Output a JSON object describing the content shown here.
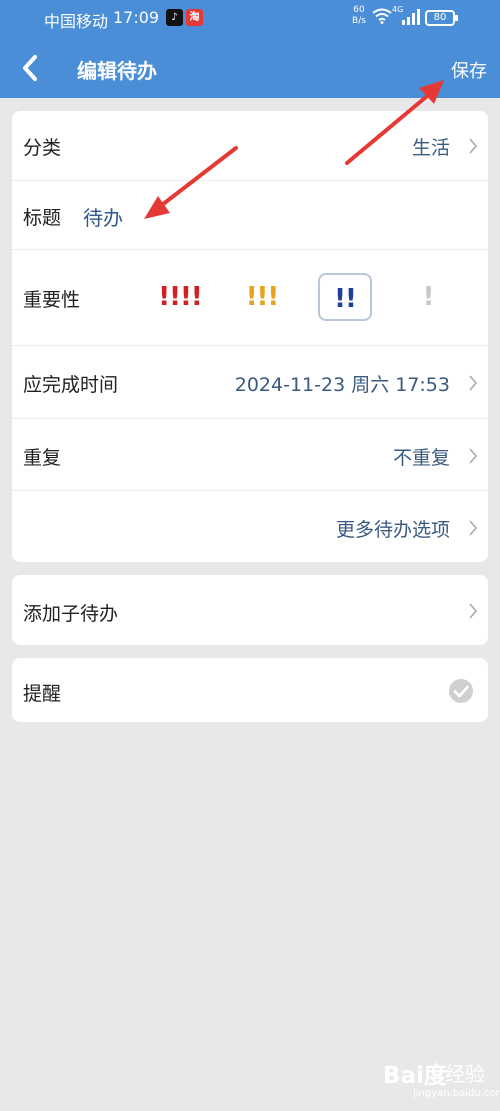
{
  "status_bar": {
    "carrier": "中国移动",
    "time": "17:09",
    "net_speed_value": "60",
    "net_speed_unit": "B/s",
    "network_type": "4G",
    "battery": "80"
  },
  "header": {
    "title": "编辑待办",
    "save_label": "保存"
  },
  "form": {
    "category": {
      "label": "分类",
      "value": "生活"
    },
    "title": {
      "label": "标题",
      "value": "待办"
    },
    "importance": {
      "label": "重要性",
      "levels": [
        {
          "marks": "!!!!",
          "color": "#d21f1f"
        },
        {
          "marks": "!!!",
          "color": "#e8a21b"
        },
        {
          "marks": "!!",
          "color": "#1f3f9c"
        },
        {
          "marks": "!",
          "color": "#c9c9c9"
        }
      ],
      "selected_index": 2
    },
    "due_time": {
      "label": "应完成时间",
      "value": "2024-11-23 周六 17:53"
    },
    "repeat": {
      "label": "重复",
      "value": "不重复"
    },
    "more_options": {
      "label": "更多待办选项"
    }
  },
  "subtask": {
    "label": "添加子待办"
  },
  "reminder": {
    "label": "提醒",
    "enabled": true
  },
  "colors": {
    "header_bg": "#4a8ed8",
    "page_bg": "#e8e8e8",
    "value_text": "#3a5a80",
    "annotation_arrow": "#e53935"
  },
  "watermark": {
    "logo": "Bai度",
    "cn": "经验",
    "url": "jingyan.baidu.com"
  }
}
